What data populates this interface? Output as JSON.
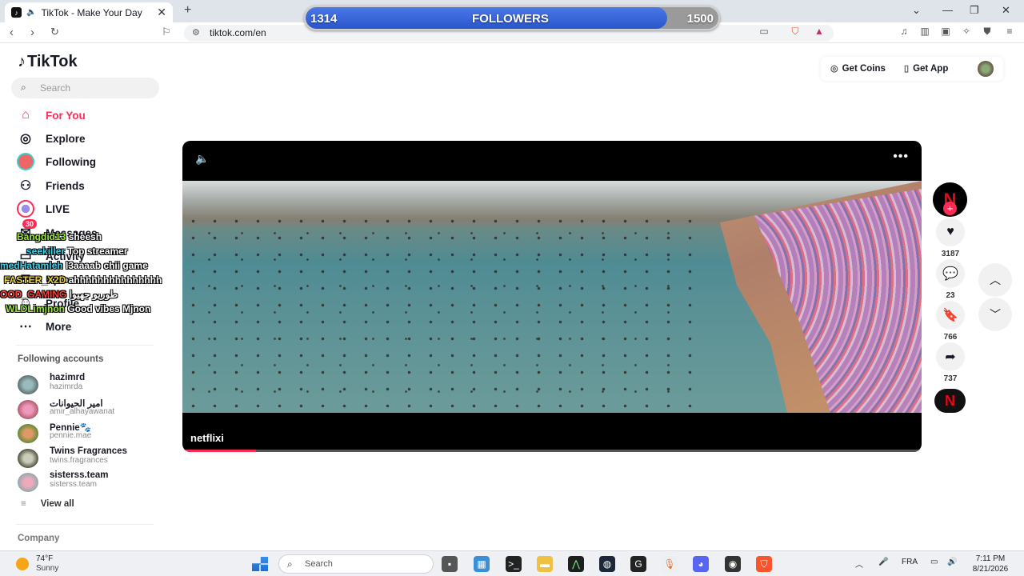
{
  "browser": {
    "tab_title": "TikTok - Make Your Day",
    "url": "tiktok.com/en"
  },
  "followers_bar": {
    "current": "1314",
    "label": "FOLLOWERS",
    "goal": "1500",
    "progress": 0.876
  },
  "sidebar": {
    "logo": "TikTok",
    "search_placeholder": "Search",
    "nav": [
      {
        "label": "For You",
        "icon": "home-icon",
        "active": true
      },
      {
        "label": "Explore",
        "icon": "compass-icon"
      },
      {
        "label": "Following",
        "icon": "avatar-icon"
      },
      {
        "label": "Friends",
        "icon": "friends-icon"
      },
      {
        "label": "LIVE",
        "icon": "live-icon"
      },
      {
        "label": "Messages",
        "icon": "messages-icon",
        "badge": "30"
      },
      {
        "label": "Activity",
        "icon": "activity-icon"
      },
      {
        "label": "Upload",
        "icon": "upload-icon"
      },
      {
        "label": "Profile",
        "icon": "profile-icon"
      },
      {
        "label": "More",
        "icon": "more-dots-icon"
      }
    ],
    "following_title": "Following accounts",
    "accounts": [
      {
        "name": "hazimrd",
        "handle": "hazimrda"
      },
      {
        "name": "امير الحيوانات",
        "handle": "amir_alhayawanat"
      },
      {
        "name": "Pennie🐾",
        "handle": "pennie.mae"
      },
      {
        "name": "Twins Fragrances",
        "handle": "twins.fragrances"
      },
      {
        "name": "sisterss.team",
        "handle": "sisterss.team"
      }
    ],
    "view_all": "View all",
    "company": "Company"
  },
  "chat_overlay": [
    {
      "user": "Bangdid13",
      "message": "sheesh",
      "color": "#9be83a"
    },
    {
      "user": "seekiller",
      "message": "Top streamer",
      "color": "#3ad0e8"
    },
    {
      "user": "medHatamleh",
      "message": "l3aaaab chii game",
      "color": "#3ad0e8"
    },
    {
      "user": "FASTER_X2D",
      "message": "ahhhhhhhhhhhhhhh",
      "color": "#e8d23a"
    },
    {
      "user": "OOD_GAMING",
      "message": "طوريو جهيوا",
      "color": "#ff3b3b"
    },
    {
      "user": "WLDLimjnon",
      "message": "Good vibes Mjnon",
      "color": "#9be83a"
    }
  ],
  "header": {
    "get_coins": "Get Coins",
    "get_app": "Get App"
  },
  "video": {
    "author": "netflixi",
    "progress": 0.1
  },
  "actions": {
    "likes": "3187",
    "comments": "23",
    "saves": "766",
    "shares": "737"
  },
  "taskbar": {
    "weather_temp": "74°F",
    "weather_desc": "Sunny",
    "search_placeholder": "Search",
    "language": "FRA",
    "time": "7:11 PM",
    "date": "8/21/2026"
  }
}
